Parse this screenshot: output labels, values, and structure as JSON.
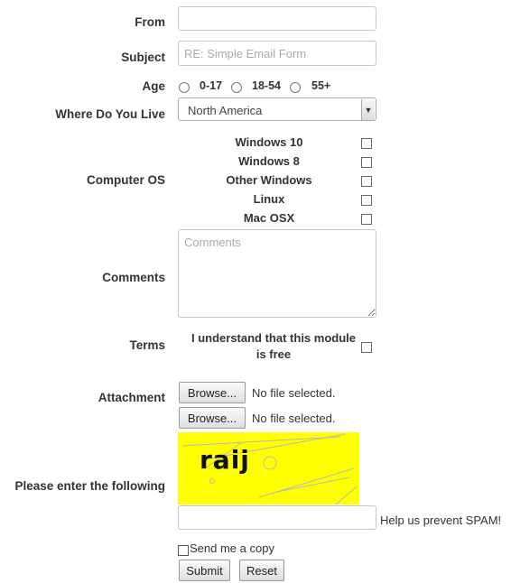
{
  "form": {
    "from": {
      "label": "From",
      "value": "",
      "placeholder": ""
    },
    "subject": {
      "label": "Subject",
      "value": "",
      "placeholder": "RE: Simple Email Form"
    },
    "age": {
      "label": "Age",
      "options": [
        "0-17",
        "18-54",
        "55+"
      ],
      "selected": null
    },
    "location": {
      "label": "Where Do You Live",
      "selected": "North America"
    },
    "computer_os": {
      "label": "Computer OS",
      "options": [
        {
          "label": "Windows 10",
          "checked": false
        },
        {
          "label": "Windows 8",
          "checked": false
        },
        {
          "label": "Other Windows",
          "checked": false
        },
        {
          "label": "Linux",
          "checked": false
        },
        {
          "label": "Mac OSX",
          "checked": false
        }
      ]
    },
    "comments": {
      "label": "Comments",
      "value": "",
      "placeholder": "Comments"
    },
    "terms": {
      "label": "Terms",
      "text": "I understand that this module is free",
      "checked": false
    },
    "attachment": {
      "label": "Attachment",
      "files": [
        {
          "button": "Browse...",
          "status": "No file selected."
        },
        {
          "button": "Browse...",
          "status": "No file selected."
        }
      ]
    },
    "captcha": {
      "label": "Please enter the following",
      "text": "raij",
      "background": "#ffff00",
      "value": "",
      "hint": "Help us prevent SPAM!"
    },
    "send_copy": {
      "label": "Send me a copy",
      "checked": false
    },
    "actions": {
      "submit": "Submit",
      "reset": "Reset"
    }
  }
}
